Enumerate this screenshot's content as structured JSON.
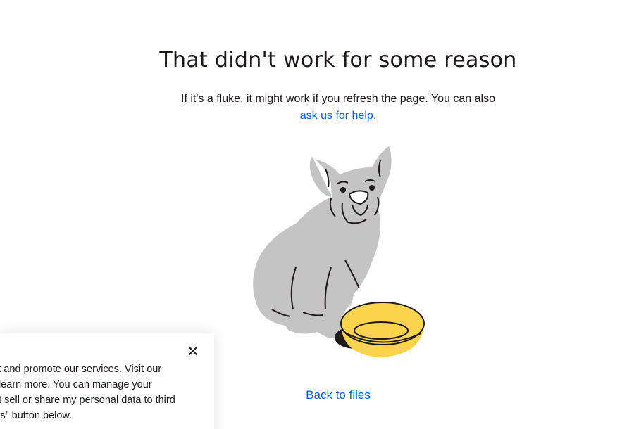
{
  "error": {
    "title": "That didn't work for some reason",
    "message": "If it's a fluke, it might work if you refresh the page. You can also",
    "help_link": "ask us for help."
  },
  "illustration": {
    "icon": "sad-dog-with-empty-bowl-illustration",
    "colors": {
      "dog": "#c4c4c4",
      "bowl": "#fcd34d",
      "ink": "#1e1919"
    }
  },
  "back_link": "Back to files",
  "cookie_banner": {
    "lines": [
      "ect and promote our services. Visit our",
      "learn more. You can manage your",
      "not sell or share my personal data to third",
      "kies” button below."
    ],
    "close_icon": "close-icon"
  },
  "colors": {
    "link": "#0061fe",
    "text": "#1e1919"
  }
}
